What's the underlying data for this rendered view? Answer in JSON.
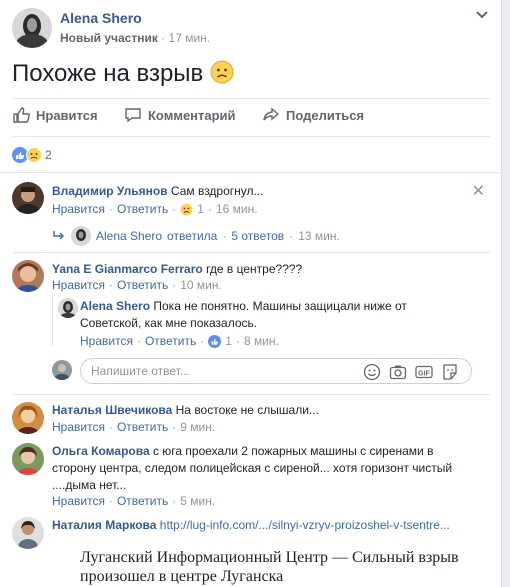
{
  "post": {
    "author": "Alena Shero",
    "role": "Новый участник",
    "dot": "·",
    "time": "17 мин.",
    "text": "Похоже на взрыв"
  },
  "actions": {
    "like": "Нравится",
    "comment": "Комментарий",
    "share": "Поделиться"
  },
  "reactions": {
    "count": "2"
  },
  "comments": [
    {
      "author": "Владимир Ульянов",
      "text": "Сам вздрогнул...",
      "like": "Нравится",
      "reply": "Ответить",
      "reaction_count": "1",
      "time": "16 мин.",
      "replies_summary": {
        "author": "Alena Shero",
        "action": "ответила",
        "count": "5 ответов",
        "time": "13 мин."
      }
    },
    {
      "author": "Yana E Gianmarco Ferraro",
      "text": "где в центре????",
      "like": "Нравится",
      "reply": "Ответить",
      "time": "10 мин.",
      "reply_item": {
        "author": "Alena Shero",
        "text_line1": "Пока не понятно. Машины защицали ниже от",
        "text_line2": "Советской, как мне показалось.",
        "like": "Нравится",
        "reply": "Ответить",
        "reaction_count": "1",
        "time": "8 мин."
      }
    },
    {
      "author": "Наталья Швечикова",
      "text": "На востоке не слышали...",
      "like": "Нравится",
      "reply": "Ответить",
      "time": "9 мин."
    },
    {
      "author": "Ольга Комарова",
      "text_line1": "с юга проехали 2 пожарных машины с сиренами в",
      "text_line2": "сторону центра, следом полицейская с сиреной... хотя горизонт чистый",
      "text_line3": "....дыма нет...",
      "like": "Нравится",
      "reply": "Ответить",
      "time": "5 мин."
    },
    {
      "author": "Наталия Маркова",
      "link": "http://lug-info.com/.../silnyi-vzryv-proizoshel-v-tsentre..."
    }
  ],
  "reply_input": {
    "placeholder": "Напишите ответ..."
  },
  "link_preview": {
    "title": "Луганский Информационный Центр — Сильный взрыв произошел в центре Луганска"
  },
  "colors": {
    "link": "#4267b2",
    "name": "#365899",
    "muted": "#90949c"
  }
}
